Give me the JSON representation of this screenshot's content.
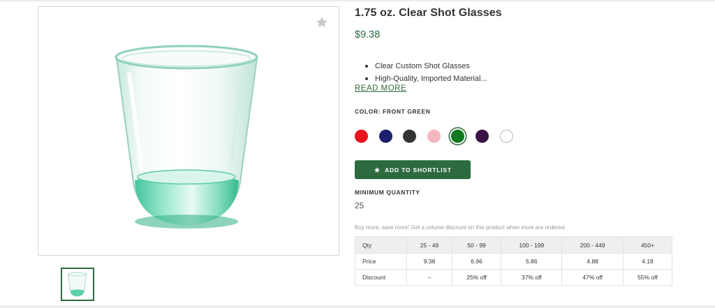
{
  "product": {
    "title": "1.75 oz. Clear Shot Glasses",
    "price": "$9.38",
    "bullets": [
      "Clear Custom Shot Glasses",
      "High-Quality, Imported Material..."
    ],
    "read_more": "READ MORE"
  },
  "color": {
    "label": "COLOR: FRONT GREEN",
    "swatches": [
      {
        "name": "red",
        "hex": "#e8141b"
      },
      {
        "name": "navy",
        "hex": "#1b1f6e"
      },
      {
        "name": "charcoal",
        "hex": "#333333"
      },
      {
        "name": "pink",
        "hex": "#f5b6c2"
      },
      {
        "name": "green",
        "hex": "#0c7a1d",
        "selected": true
      },
      {
        "name": "purple",
        "hex": "#3a1346"
      },
      {
        "name": "white",
        "hex": "#ffffff"
      }
    ]
  },
  "actions": {
    "shortlist_label": "ADD TO SHORTLIST",
    "accent": "#2d6a3e"
  },
  "quantity": {
    "label": "MINIMUM QUANTITY",
    "value": "25"
  },
  "pricing": {
    "note": "Buy more, save more! Get a volume discount on this product when more are ordered.",
    "header": [
      "Qty",
      "25 - 49",
      "50 - 99",
      "100 - 199",
      "200 - 449",
      "450+"
    ],
    "price_row": [
      "Price",
      "9.38",
      "6.96",
      "5.86",
      "4.88",
      "4.18"
    ],
    "discount_row": [
      "Discount",
      "--",
      "25% off",
      "37% off",
      "47% off",
      "55% off"
    ]
  },
  "icons": {
    "favorite": "star-icon",
    "shortlist": "star-icon"
  }
}
